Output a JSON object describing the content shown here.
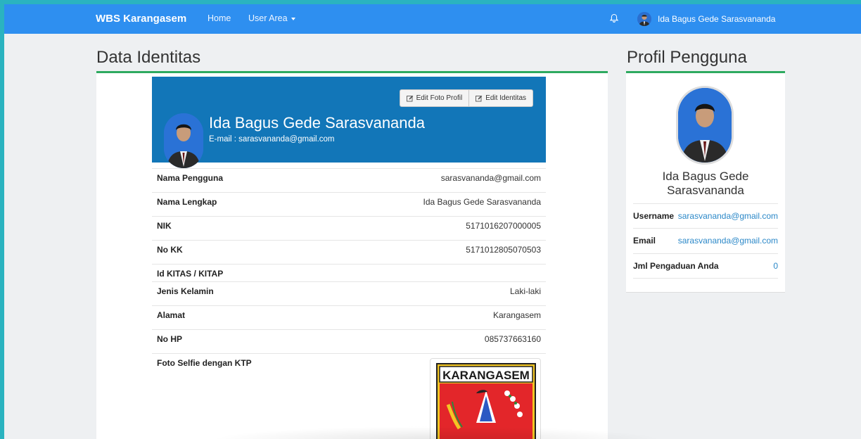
{
  "navbar": {
    "brand": "WBS Karangasem",
    "home": "Home",
    "user_area": "User Area",
    "username": "Ida Bagus Gede Sarasvananda"
  },
  "left": {
    "title": "Data Identitas",
    "buttons": {
      "edit_photo": "Edit Foto Profil",
      "edit_identity": "Edit Identitas"
    },
    "name": "Ida Bagus Gede Sarasvananda",
    "email_line": "E-mail : sarasvananda@gmail.com",
    "rows": [
      {
        "label": "Nama Pengguna",
        "value": "sarasvananda@gmail.com"
      },
      {
        "label": "Nama Lengkap",
        "value": "Ida Bagus Gede Sarasvananda"
      },
      {
        "label": "NIK",
        "value": "5171016207000005"
      },
      {
        "label": "No KK",
        "value": "5171012805070503"
      },
      {
        "label": "Id KITAS / KITAP",
        "value": ""
      },
      {
        "label": "Jenis Kelamin",
        "value": "Laki-laki"
      },
      {
        "label": "Alamat",
        "value": "Karangasem"
      },
      {
        "label": "No HP",
        "value": "085737663160"
      },
      {
        "label": "Foto Selfie dengan KTP",
        "value": ""
      }
    ],
    "ktp_logo_text": "KARANGASEM"
  },
  "right": {
    "title": "Profil Pengguna",
    "name": "Ida Bagus Gede Sarasvananda",
    "rows": [
      {
        "label": "Username",
        "value": "sarasvananda@gmail.com"
      },
      {
        "label": "Email",
        "value": "sarasvananda@gmail.com"
      },
      {
        "label": "Jml Pengaduan Anda",
        "value": "0"
      }
    ]
  },
  "colors": {
    "navbar": "#2e8ff0",
    "card_header": "#1276b8",
    "accent_line": "#2eaa60",
    "link": "#2b88c8"
  }
}
